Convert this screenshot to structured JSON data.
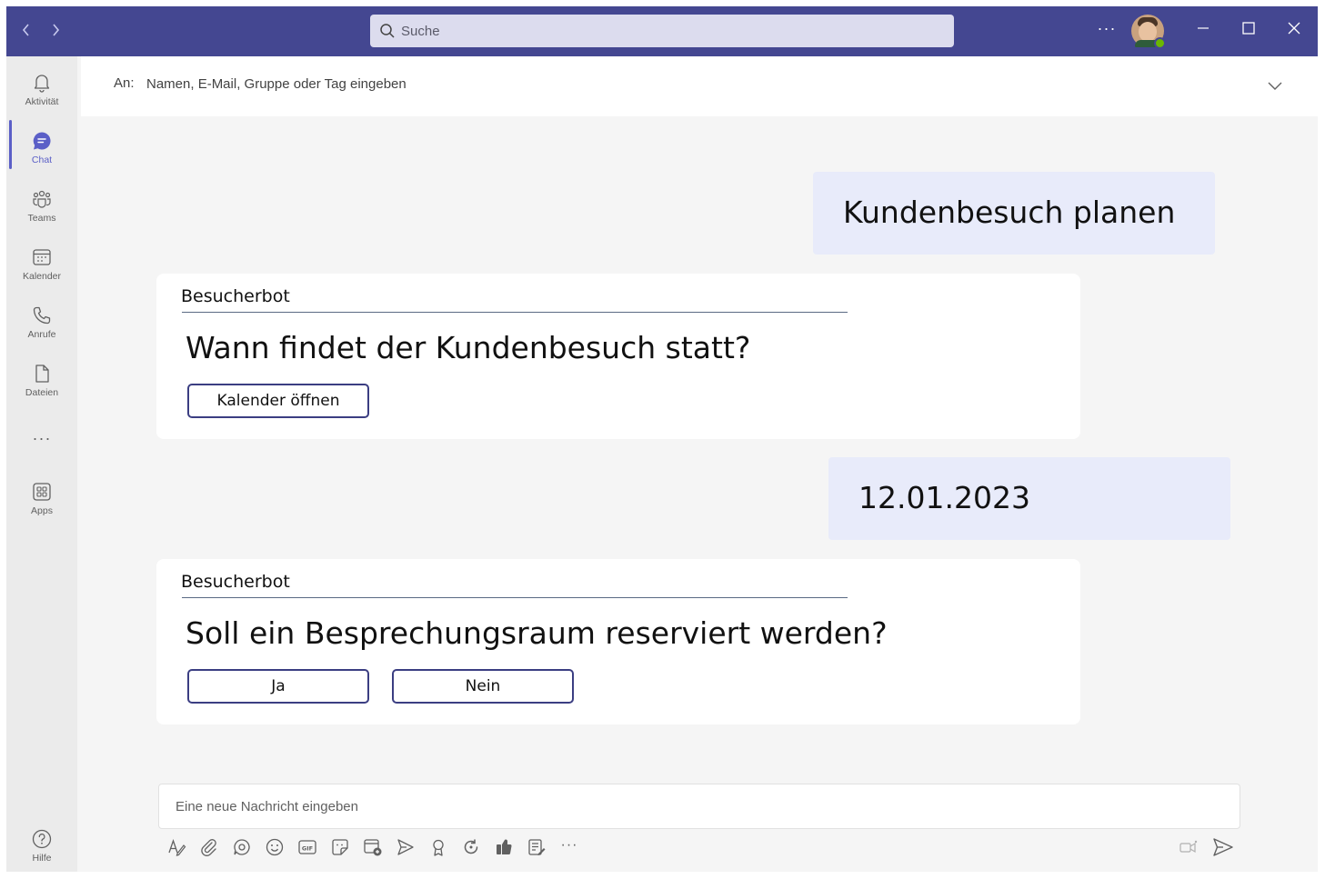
{
  "search": {
    "placeholder": "Suche"
  },
  "titlebar": {
    "more_label": "···"
  },
  "rail": {
    "items": [
      {
        "label": "Aktivität"
      },
      {
        "label": "Chat"
      },
      {
        "label": "Teams"
      },
      {
        "label": "Kalender"
      },
      {
        "label": "Anrufe"
      },
      {
        "label": "Dateien"
      },
      {
        "label": "Apps"
      },
      {
        "label": "Hilfe"
      }
    ],
    "more_label": "···"
  },
  "tobar": {
    "label": "An:",
    "placeholder": "Namen, E-Mail, Gruppe oder Tag eingeben"
  },
  "messages": {
    "user1": "Kundenbesuch planen",
    "bot1": {
      "sender": "Besucherbot",
      "question": "Wann findet der Kundenbesuch statt?",
      "button": "Kalender öffnen"
    },
    "user2": "12.01.2023",
    "bot2": {
      "sender": "Besucherbot",
      "question": "Soll ein Besprechungsraum reserviert werden?",
      "yes": "Ja",
      "no": "Nein"
    }
  },
  "compose": {
    "placeholder": "Eine neue Nachricht eingeben",
    "more_label": "···"
  },
  "colors": {
    "titlebar": "#444791",
    "accent": "#5b5fc7",
    "user_bubble": "#e8ebfa",
    "button_border": "#3b3e82"
  }
}
